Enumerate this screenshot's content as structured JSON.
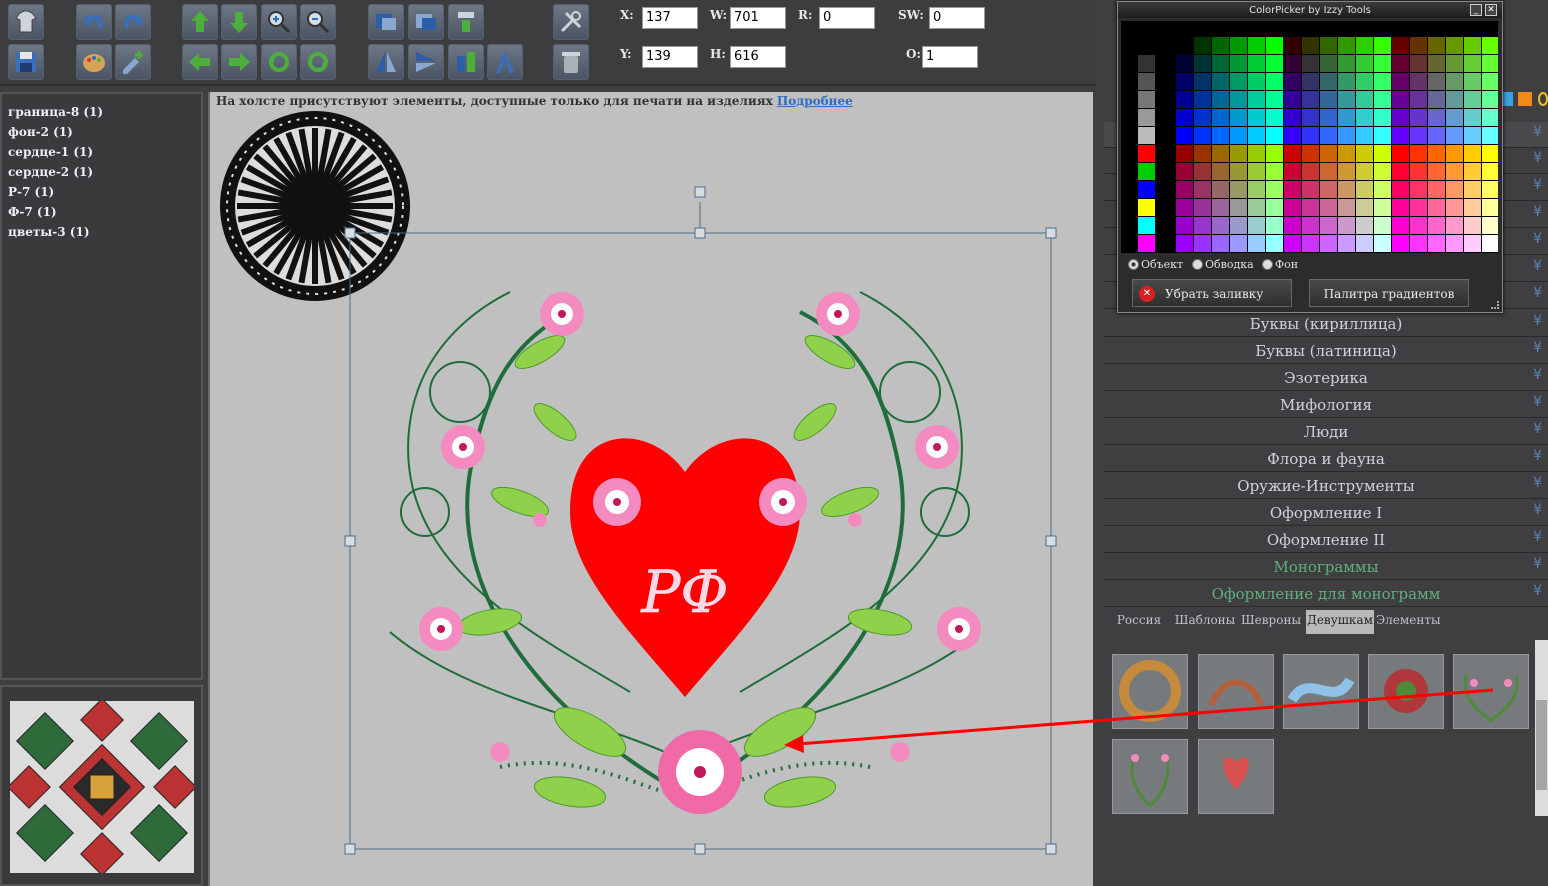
{
  "fields": {
    "x": {
      "label": "X:",
      "value": "137"
    },
    "y": {
      "label": "Y:",
      "value": "139"
    },
    "w": {
      "label": "W:",
      "value": "701"
    },
    "h": {
      "label": "H:",
      "value": "616"
    },
    "r": {
      "label": "R:",
      "value": "0"
    },
    "sw": {
      "label": "SW:",
      "value": "0"
    },
    "o": {
      "label": "O:",
      "value": "1"
    }
  },
  "layers": [
    "граница-8 (1)",
    "фон-2 (1)",
    "сердце-1 (1)",
    "сердце-2 (1)",
    "Р-7 (1)",
    "Ф-7 (1)",
    "цветы-3 (1)"
  ],
  "canvas": {
    "notice": "На холсте присутствуют элементы, доступные только для печати на изделиях",
    "notice_link": "Подробнее",
    "monogram": "РФ"
  },
  "colorpicker": {
    "title": "ColorPicker by Izzy Tools",
    "radio_object": "Объект",
    "radio_stroke": "Обводка",
    "radio_bg": "Фон",
    "remove_fill": "Убрать заливку",
    "gradient_palette": "Палитра градиентов"
  },
  "categories": [
    "Буквы (кириллица)",
    "Буквы (латиница)",
    "Эзотерика",
    "Мифология",
    "Люди",
    "Флора и фауна",
    "Оружие-Инструменты",
    "Оформление I",
    "Оформление II",
    "Монограммы",
    "Оформление для монограмм"
  ],
  "tabs": [
    "Россия",
    "Шаблоны",
    "Шевроны",
    "Девушкам",
    "Элементы"
  ],
  "active_tab": "Девушкам",
  "colors": {
    "heart": "#ff0000",
    "accent_green": "#5fb07a",
    "link": "#2d6cc0",
    "arrow": "#ff0000"
  }
}
